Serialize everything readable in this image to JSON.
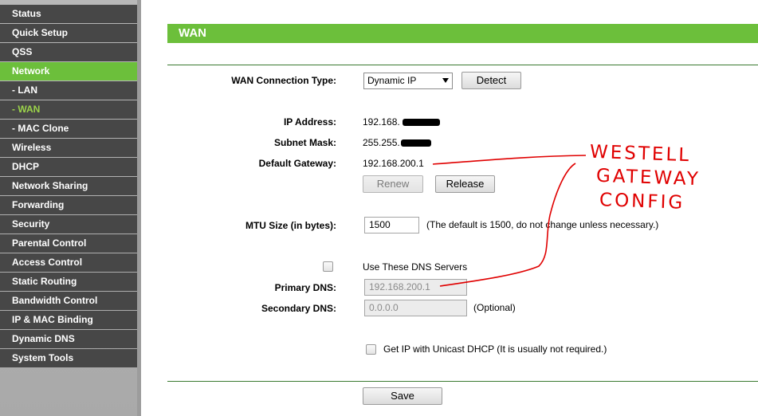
{
  "sidebar": {
    "items": [
      {
        "label": "Status"
      },
      {
        "label": "Quick Setup"
      },
      {
        "label": "QSS"
      },
      {
        "label": "Network"
      },
      {
        "label": "- LAN"
      },
      {
        "label": "- WAN"
      },
      {
        "label": "- MAC Clone"
      },
      {
        "label": "Wireless"
      },
      {
        "label": "DHCP"
      },
      {
        "label": "Network Sharing"
      },
      {
        "label": "Forwarding"
      },
      {
        "label": "Security"
      },
      {
        "label": "Parental Control"
      },
      {
        "label": "Access Control"
      },
      {
        "label": "Static Routing"
      },
      {
        "label": "Bandwidth Control"
      },
      {
        "label": "IP & MAC Binding"
      },
      {
        "label": "Dynamic DNS"
      },
      {
        "label": "System Tools"
      }
    ]
  },
  "page": {
    "title": "WAN",
    "accent_color": "#6cbf3b"
  },
  "wan": {
    "connection_type_label": "WAN Connection Type:",
    "connection_type_value": "Dynamic IP",
    "detect_label": "Detect",
    "ip_label": "IP Address:",
    "ip_value": "192.168.",
    "subnet_label": "Subnet Mask:",
    "subnet_value": "255.255.",
    "gateway_label": "Default Gateway:",
    "gateway_value": "192.168.200.1",
    "renew_label": "Renew",
    "release_label": "Release",
    "mtu_label": "MTU Size (in bytes):",
    "mtu_value": "1500",
    "mtu_note": "(The default is 1500, do not change unless necessary.)",
    "dns_checkbox_label": "Use These DNS Servers",
    "primary_dns_label": "Primary DNS:",
    "primary_dns_value": "192.168.200.1",
    "secondary_dns_label": "Secondary DNS:",
    "secondary_dns_value": "0.0.0.0",
    "optional_note": "(Optional)",
    "unicast_label": "Get IP with Unicast DHCP (It is usually not required.)",
    "save_label": "Save"
  },
  "annotation": {
    "line1": "WESTELL",
    "line2": "GATEWAY",
    "line3": "CONFIG",
    "color": "#e00000"
  }
}
